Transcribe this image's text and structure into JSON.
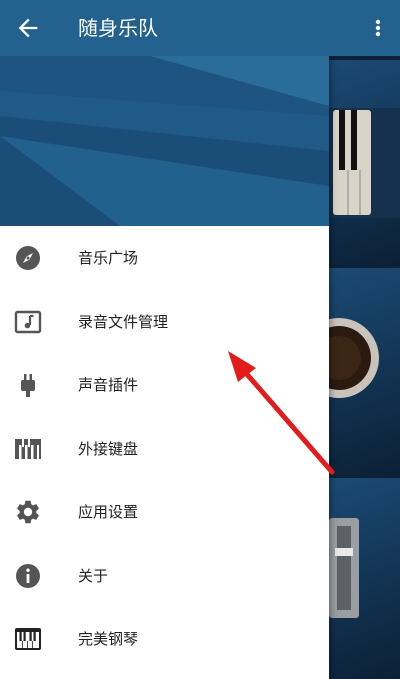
{
  "appbar": {
    "title": "随身乐队",
    "back_icon": "arrow-left-icon",
    "more_icon": "more-vert-icon"
  },
  "menu": {
    "items": [
      {
        "label": "音乐广场",
        "icon": "compass-icon"
      },
      {
        "label": "录音文件管理",
        "icon": "music-note-file-icon"
      },
      {
        "label": "声音插件",
        "icon": "plug-icon"
      },
      {
        "label": "外接键盘",
        "icon": "keyboard-icon"
      },
      {
        "label": "应用设置",
        "icon": "gear-icon"
      },
      {
        "label": "关于",
        "icon": "info-icon"
      },
      {
        "label": "完美钢琴",
        "icon": "piano-icon"
      }
    ]
  },
  "colors": {
    "appbar": "#23628f",
    "icon": "#555555",
    "annotation_arrow": "#e31b1b"
  }
}
